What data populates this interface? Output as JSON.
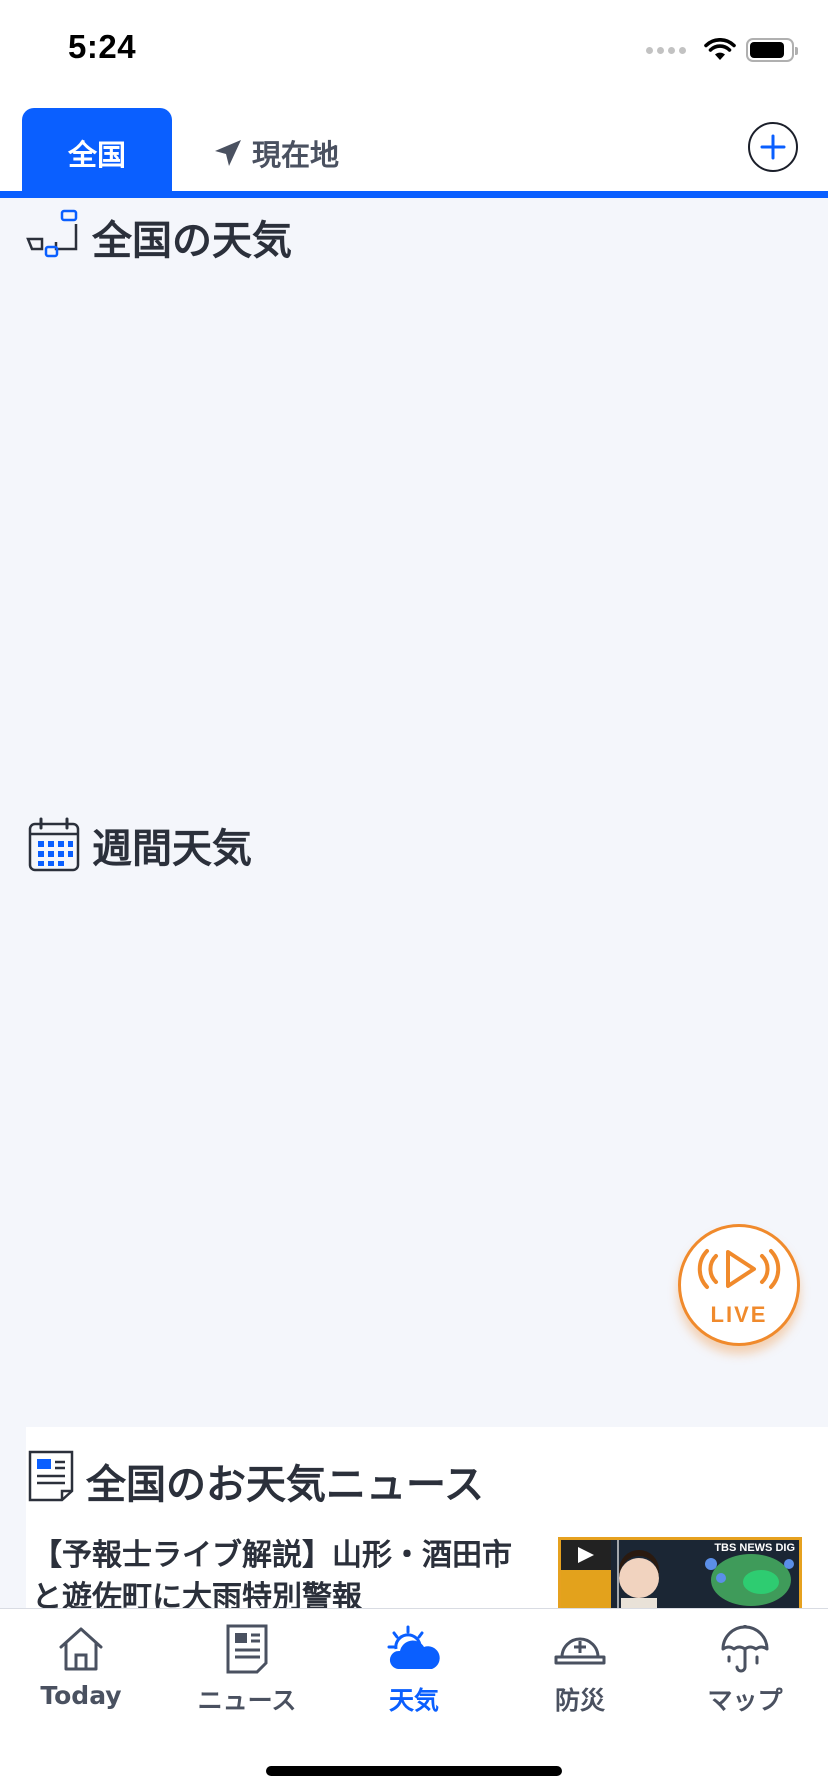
{
  "status_bar": {
    "time": "5:24"
  },
  "tabs": {
    "active_label": "全国",
    "current_location_label": "現在地",
    "add_icon": "plus-circle-icon",
    "accent_color": "#0a5fff"
  },
  "sections": {
    "national_weather_title": "全国の天気",
    "weekly_weather_title": "週間天気",
    "weather_news_title": "全国のお天気ニュース"
  },
  "news": {
    "items": [
      {
        "headline_line1": "【予報士ライブ解説】山形・酒田市",
        "headline_line2": "と遊佐町に大雨特別警報",
        "thumb_brand": "TBS NEWS DIG"
      }
    ]
  },
  "live_button": {
    "label": "LIVE",
    "color": "#f08a2c"
  },
  "bottom_nav": {
    "items": [
      {
        "label": "Today",
        "icon": "home-icon"
      },
      {
        "label": "ニュース",
        "icon": "newspaper-icon"
      },
      {
        "label": "天気",
        "icon": "weather-icon"
      },
      {
        "label": "防災",
        "icon": "helmet-icon"
      },
      {
        "label": "マップ",
        "icon": "umbrella-map-icon"
      }
    ],
    "active_index": 2
  }
}
